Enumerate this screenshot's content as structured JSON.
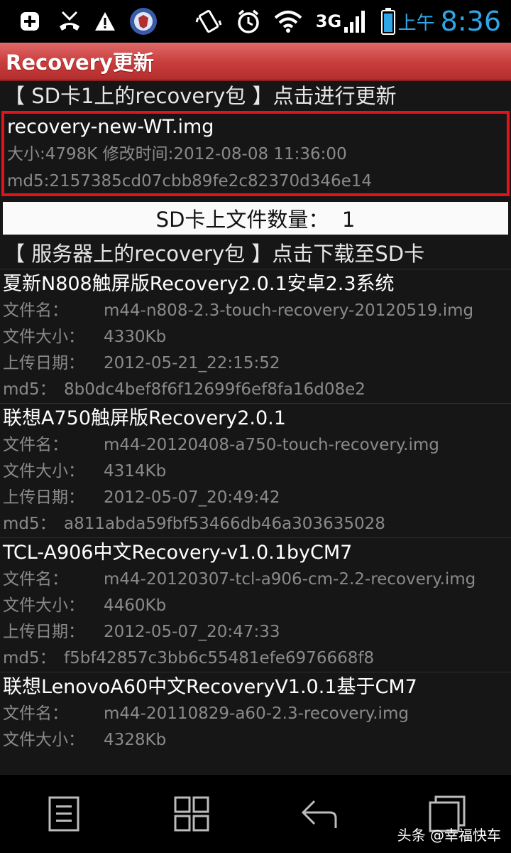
{
  "status_bar": {
    "ampm": "上午",
    "time": "8:36",
    "network": "3G",
    "time_color": "#2ea7e8",
    "icons": [
      "add-notification-icon",
      "missed-call-icon",
      "warning-icon",
      "app-badge-icon",
      "vibrate-icon",
      "alarm-icon",
      "wifi-icon",
      "signal-icon",
      "battery-icon"
    ]
  },
  "app_title": "Recovery更新",
  "accent_color": "#c83c3c",
  "local_section_header": "【 SD卡1上的recovery包 】点击进行更新",
  "local_item": {
    "name": "recovery-new-WT.img",
    "info": "大小:4798K 修改时间:2012-08-08 11:36:00",
    "md5": "md5:2157385cd07cbb89fe2c82370d346e14",
    "highlight_color": "#e0141a"
  },
  "file_count": "SD卡上文件数量：  1",
  "server_section_header": "【 服务器上的recovery包 】点击下载至SD卡",
  "field_labels": {
    "filename": "文件名：",
    "size": "文件大小：",
    "date": "上传日期：",
    "md5": "md5："
  },
  "server_items": [
    {
      "title": "夏新N808触屏版Recovery2.0.1安卓2.3系统",
      "filename": "m44-n808-2.3-touch-recovery-20120519.img",
      "size": "4330Kb",
      "date": "2012-05-21_22:15:52",
      "md5": "8b0dc4bef8f6f12699f6ef8fa16d08e2"
    },
    {
      "title": "联想A750触屏版Recovery2.0.1",
      "filename": "m44-20120408-a750-touch-recovery.img",
      "size": "4314Kb",
      "date": "2012-05-07_20:49:42",
      "md5": "a811abda59fbf53466db46a303635028"
    },
    {
      "title": "TCL-A906中文Recovery-v1.0.1byCM7",
      "filename": "m44-20120307-tcl-a906-cm-2.2-recovery.img",
      "size": "4460Kb",
      "date": "2012-05-07_20:47:33",
      "md5": "f5bf42857c3bb6c55481efe6976668f8"
    },
    {
      "title": "联想LenovoA60中文RecoveryV1.0.1基于CM7",
      "filename": "m44-20110829-a60-2.3-recovery.img",
      "size": "4328Kb"
    }
  ],
  "nav_bar": {
    "icons": [
      "menu-icon",
      "home-icon",
      "back-icon",
      "recent-apps-icon"
    ]
  },
  "watermark": "头条 @幸福快车"
}
